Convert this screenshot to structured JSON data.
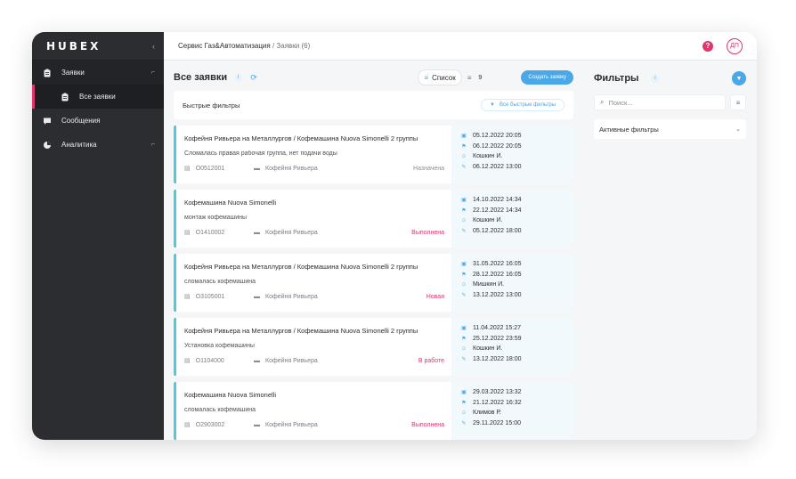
{
  "sidebar": {
    "logo": "HUBEX",
    "collapse_glyph": "‹",
    "items": [
      {
        "label": "Заявки",
        "icon": "clipboard-icon",
        "chevron": "⌐"
      },
      {
        "label": "Все заявки",
        "icon": "clipboard-icon"
      },
      {
        "label": "Сообщения",
        "icon": "chat-icon"
      },
      {
        "label": "Аналитика",
        "icon": "pie-chart-icon",
        "chevron": "⌐"
      }
    ]
  },
  "topbar": {
    "service": "Сервис Газ&Автоматизация",
    "separator": "/",
    "current": "Заявки (6)",
    "help_glyph": "?",
    "avatar_initials": "ДП"
  },
  "list": {
    "title": "Все заявки",
    "info_glyph": "i",
    "view_label": "Список",
    "view_count": "9",
    "create_label": "Создать заявку",
    "quick_filters_label": "Быстрые фильтры",
    "all_quick_filters_label": "Все быстрые фильтры"
  },
  "cards": [
    {
      "title": "Кофейня Ривьера на Металлургов / Кофемашина Nuova Simonelli 2 группы",
      "desc": "Сломалась правая рабочая группа, нет подачи воды",
      "number": "O0512001",
      "company": "Кофейня Ривьера",
      "status": "Назначена",
      "status_color": "#8a8d93",
      "created": "05.12.2022 20:05",
      "deadline": "06.12.2022 20:05",
      "assignee": "Кошкин И.",
      "work": "06.12.2022 13:00"
    },
    {
      "title": "Кофемашина Nuova Simonelli",
      "desc": "монтаж кофемашины",
      "number": "O1410002",
      "company": "Кофейня Ривьера",
      "status": "Выполнена",
      "status_color": "#e0366b",
      "created": "14.10.2022 14:34",
      "deadline": "22.12.2022 14:34",
      "assignee": "Кошкин И.",
      "work": "05.12.2022 18:00"
    },
    {
      "title": "Кофейня Ривьера на Металлургов / Кофемашина Nuova Simonelli 2 группы",
      "desc": "сломалась кофемашина",
      "number": "O3105001",
      "company": "Кофейня Ривьера",
      "status": "Новая",
      "status_color": "#e0366b",
      "created": "31.05.2022 16:05",
      "deadline": "28.12.2022 16:05",
      "assignee": "Мишкин И.",
      "work": "13.12.2022 13:00"
    },
    {
      "title": "Кофейня Ривьера на Металлургов / Кофемашина Nuova Simonelli 2 группы",
      "desc": "Установка кофемашины",
      "number": "O1104000",
      "company": "Кофейня Ривьера",
      "status": "В работе",
      "status_color": "#e0366b",
      "created": "11.04.2022 15:27",
      "deadline": "25.12.2022 23:59",
      "assignee": "Кошкин И.",
      "work": "13.12.2022 18:00"
    },
    {
      "title": "Кофемашина Nuova Simonelli",
      "desc": "сломалась кофемашина",
      "number": "O2903002",
      "company": "Кофейня Ривьера",
      "status": "Выполнена",
      "status_color": "#e0366b",
      "created": "29.03.2022 13:32",
      "deadline": "21.12.2022 16:32",
      "assignee": "Климов Р.",
      "work": "29.11.2022 15:00"
    }
  ],
  "filters": {
    "title": "Фильтры",
    "info_glyph": "i",
    "search_placeholder": "Поиск...",
    "active_filters_label": "Активные фильтры"
  },
  "colors": {
    "accent": "#4aa8e8",
    "brand": "#e0366b",
    "card_border": "#4dcbd8",
    "sidebar_bg": "#2b2d31"
  }
}
